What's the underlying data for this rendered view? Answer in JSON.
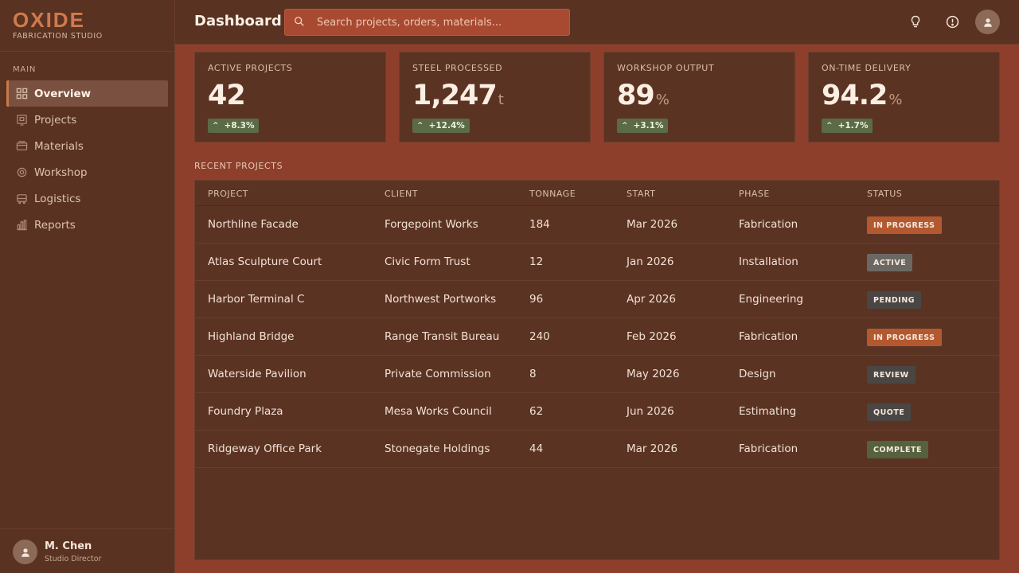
{
  "brand": {
    "name": "OXIDE",
    "subtitle": "FABRICATION STUDIO"
  },
  "sidebar": {
    "section_label": "MAIN",
    "items": [
      {
        "label": "Overview",
        "icon": "grid-icon",
        "active": true
      },
      {
        "label": "Projects",
        "icon": "projects-icon",
        "active": false
      },
      {
        "label": "Materials",
        "icon": "materials-icon",
        "active": false
      },
      {
        "label": "Workshop",
        "icon": "gear-icon",
        "active": false
      },
      {
        "label": "Logistics",
        "icon": "truck-icon",
        "active": false
      },
      {
        "label": "Reports",
        "icon": "bar-chart-icon",
        "active": false
      }
    ]
  },
  "user": {
    "name": "M. Chen",
    "role": "Studio Director"
  },
  "header": {
    "title": "Dashboard",
    "search_placeholder": "Search projects, orders, materials..."
  },
  "kpis": [
    {
      "label": "ACTIVE PROJECTS",
      "value": "42",
      "unit": "",
      "delta": "+8.3%"
    },
    {
      "label": "STEEL PROCESSED",
      "value": "1,247",
      "unit": "t",
      "delta": "+12.4%"
    },
    {
      "label": "WORKSHOP OUTPUT",
      "value": "89",
      "unit": "%",
      "delta": "+3.1%"
    },
    {
      "label": "ON-TIME DELIVERY",
      "value": "94.2",
      "unit": "%",
      "delta": "+1.7%"
    }
  ],
  "recent": {
    "title": "RECENT PROJECTS",
    "columns": [
      "PROJECT",
      "CLIENT",
      "TONNAGE",
      "START",
      "PHASE",
      "STATUS"
    ],
    "rows": [
      {
        "project": "Northline Facade",
        "client": "Forgepoint Works",
        "tonnage": "184",
        "start": "Mar 2026",
        "phase": "Fabrication",
        "status": "IN PROGRESS",
        "status_color": "#b4582f"
      },
      {
        "project": "Atlas Sculpture Court",
        "client": "Civic Form Trust",
        "tonnage": "12",
        "start": "Jan 2026",
        "phase": "Installation",
        "status": "ACTIVE",
        "status_color": "#6b6863"
      },
      {
        "project": "Harbor Terminal C",
        "client": "Northwest Portworks",
        "tonnage": "96",
        "start": "Apr 2026",
        "phase": "Engineering",
        "status": "PENDING",
        "status_color": "#4a4643"
      },
      {
        "project": "Highland Bridge",
        "client": "Range Transit Bureau",
        "tonnage": "240",
        "start": "Feb 2026",
        "phase": "Fabrication",
        "status": "IN PROGRESS",
        "status_color": "#b4582f"
      },
      {
        "project": "Waterside Pavilion",
        "client": "Private Commission",
        "tonnage": "8",
        "start": "May 2026",
        "phase": "Design",
        "status": "REVIEW",
        "status_color": "#4a4643"
      },
      {
        "project": "Foundry Plaza",
        "client": "Mesa Works Council",
        "tonnage": "62",
        "start": "Jun 2026",
        "phase": "Estimating",
        "status": "QUOTE",
        "status_color": "#4a4643"
      },
      {
        "project": "Ridgeway Office Park",
        "client": "Stonegate Holdings",
        "tonnage": "44",
        "start": "Mar 2026",
        "phase": "Fabrication",
        "status": "COMPLETE",
        "status_color": "#56613f"
      }
    ]
  }
}
